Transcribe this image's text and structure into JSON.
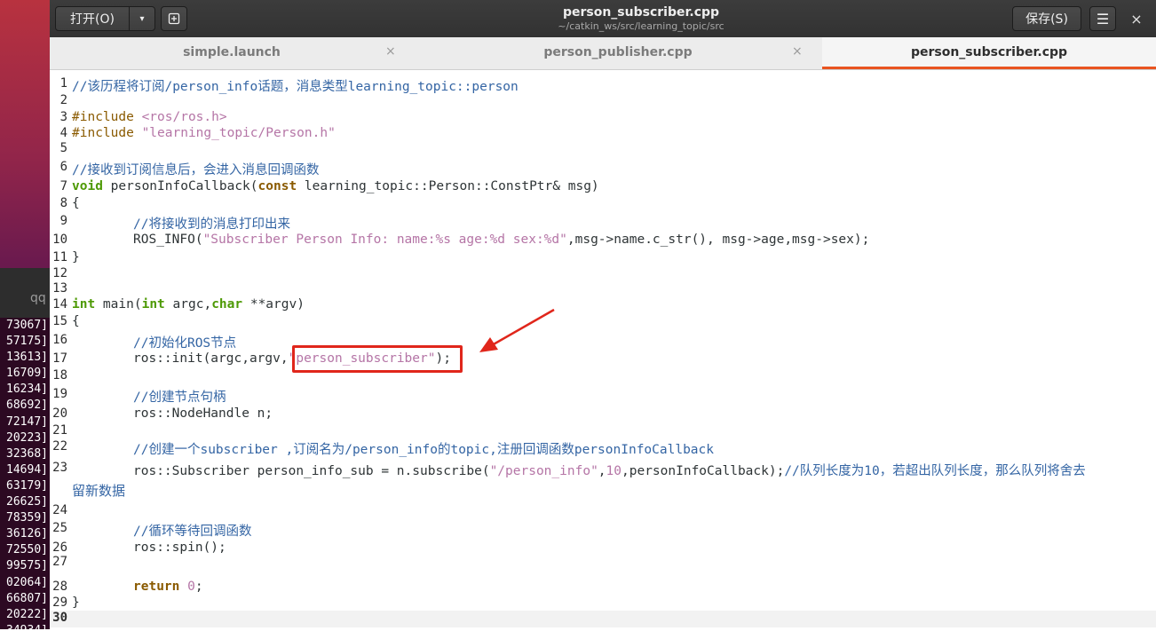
{
  "desktop": {
    "terminal_tab_label": "qq",
    "terminal_lines": [
      "73067]",
      "57175]",
      "13613]",
      "16709]",
      "16234]",
      "68692]",
      "72147]",
      "20223]",
      "32368]",
      "14694]",
      "63179]",
      "26625]",
      "78359]",
      "36126]",
      "72550]",
      "99575]",
      "02064]",
      "66807]",
      "20222]",
      "34934]"
    ]
  },
  "window": {
    "title": "person_subscriber.cpp",
    "subtitle": "~/catkin_ws/src/learning_topic/src",
    "open_label": "打开(O)",
    "open_arrow": "▾",
    "new_tab_icon": "new-document-icon",
    "save_label": "保存(S)",
    "menu_icon": "☰",
    "close_icon": "×"
  },
  "tabs": [
    {
      "label": "simple.launch",
      "close": "×",
      "active": false
    },
    {
      "label": "person_publisher.cpp",
      "close": "×",
      "active": false
    },
    {
      "label": "person_subscriber.cpp",
      "close": "",
      "active": true
    }
  ],
  "editor": {
    "lines": [
      {
        "n": "1",
        "text": "//该历程将订阅/person_info话题，消息类型learning_topic::person"
      },
      {
        "n": "2",
        "text": ""
      },
      {
        "n": "3",
        "text": "#include <ros/ros.h>"
      },
      {
        "n": "4",
        "text": "#include \"learning_topic/Person.h\""
      },
      {
        "n": "5",
        "text": ""
      },
      {
        "n": "6",
        "text": "//接收到订阅信息后，会进入消息回调函数"
      },
      {
        "n": "7",
        "text": "void personInfoCallback(const learning_topic::Person::ConstPtr& msg)"
      },
      {
        "n": "8",
        "text": "{"
      },
      {
        "n": "9",
        "text": "//将接收到的消息打印出来"
      },
      {
        "n": "10",
        "text": "ROS_INFO(\"Subscriber Person Info: name:%s age:%d sex:%d\",msg->name.c_str(), msg->age,msg->sex);"
      },
      {
        "n": "11",
        "text": "}"
      },
      {
        "n": "12",
        "text": ""
      },
      {
        "n": "13",
        "text": ""
      },
      {
        "n": "14",
        "text": "int main(int argc,char **argv)"
      },
      {
        "n": "15",
        "text": "{"
      },
      {
        "n": "16",
        "text": "//初始化ROS节点"
      },
      {
        "n": "17",
        "text": "ros::init(argc,argv,\"person_subscriber\");"
      },
      {
        "n": "18",
        "text": ""
      },
      {
        "n": "19",
        "text": "//创建节点句柄"
      },
      {
        "n": "20",
        "text": "ros::NodeHandle n;"
      },
      {
        "n": "21",
        "text": ""
      },
      {
        "n": "22",
        "text": "//创建一个subscriber ,订阅名为/person_info的topic,注册回调函数personInfoCallback"
      },
      {
        "n": "23",
        "text": "ros::Subscriber person_info_sub = n.subscribe(\"/person_info\",10,personInfoCallback);//队列长度为10，若超出队列长度，那么队列将舍去",
        "wrap": "留新数据"
      },
      {
        "n": "24",
        "text": ""
      },
      {
        "n": "25",
        "text": "//循环等待回调函数"
      },
      {
        "n": "26",
        "text": "ros::spin();"
      },
      {
        "n": "27",
        "text": ""
      },
      {
        "n": "28",
        "text": "return 0;"
      },
      {
        "n": "29",
        "text": "}"
      },
      {
        "n": "30",
        "text": ""
      }
    ]
  },
  "colors": {
    "keyword": "#8a5a00",
    "type": "#4e9a06",
    "string": "#b575a6",
    "comment": "#3465a4",
    "highlight_box": "#e0261b",
    "active_tab_underline": "#e95420"
  }
}
